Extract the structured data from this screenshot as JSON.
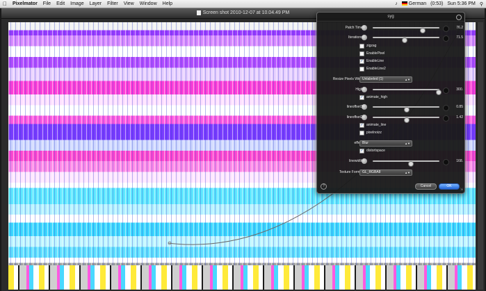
{
  "menubar": {
    "apple": "",
    "app_name": "Pixelmator",
    "menus": [
      "File",
      "Edit",
      "Image",
      "Layer",
      "Filter",
      "View",
      "Window",
      "Help"
    ],
    "status": {
      "language": "German",
      "battery": "(0:53)",
      "clock": "Sun 5:36 PM"
    }
  },
  "window": {
    "title": "Screen shot 2010-12-07 at 10.04.49 PM"
  },
  "dialog": {
    "title": "syg",
    "close_label": "",
    "rows": {
      "patch_time": {
        "label": "Patch Time:",
        "value": "76.2",
        "fraction": 0.74
      },
      "iterations": {
        "label": "Iterations:",
        "value": "71.5",
        "fraction": 0.47
      },
      "high": {
        "label": "High:",
        "value": "300.",
        "fraction": 0.98
      },
      "lineoffset1": {
        "label": "lineoffset1:",
        "value": "0.85",
        "fraction": 0.5
      },
      "lineoffset2": {
        "label": "lineoffset2:",
        "value": "1.42",
        "fraction": 0.5
      },
      "linewidth": {
        "label": "linewidth:",
        "value": "168.",
        "fraction": 0.56
      }
    },
    "checkboxes": {
      "zigzag": {
        "label": "zigzag",
        "checked": false
      },
      "enable_pixel": {
        "label": "EnablePixel",
        "checked": false
      },
      "enable_line": {
        "label": "EnableLine",
        "checked": true
      },
      "enable_line2": {
        "label": "EnableLine2",
        "checked": false
      },
      "animate_high": {
        "label": "animate_high",
        "checked": true
      },
      "animate_line": {
        "label": "animate_line",
        "checked": true
      },
      "pixelnoise": {
        "label": "pixelnoizz",
        "checked": false
      },
      "distortspace": {
        "label": "distortspace",
        "checked": true
      }
    },
    "popups": {
      "resize_pixels": {
        "label": "Resize Pixels Wide:",
        "value": "Unlabeled (1)"
      },
      "effect": {
        "label": "effect:",
        "value": "Blur"
      },
      "texture_format": {
        "label": "Texture Format:",
        "value": "GL_RGBA8"
      }
    },
    "buttons": {
      "help": "?",
      "cancel": "Cancel",
      "ok": "OK"
    }
  },
  "colors": {
    "accent": "#2466d8",
    "hud_background": "#1a1a1a"
  }
}
